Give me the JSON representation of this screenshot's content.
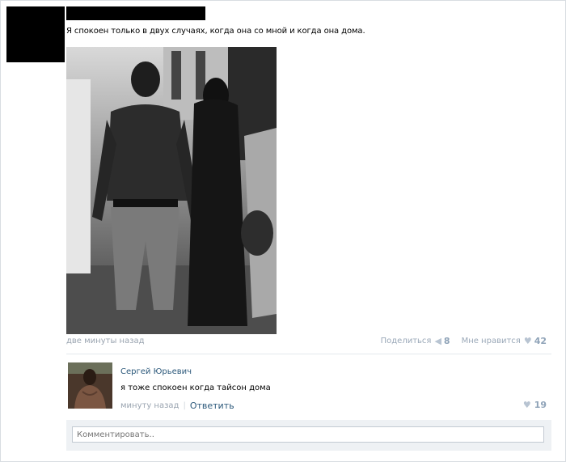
{
  "post": {
    "text": "Я спокоен только в двух случаях, когда она со мной и когда она дома.",
    "time": "две минуты назад",
    "share_label": "Поделиться",
    "share_count": "8",
    "like_label": "Мне нравится",
    "like_count": "42"
  },
  "comment": {
    "author": "Сергей Юрьевич",
    "text": "я тоже спокоен когда тайсон дома",
    "time": "минуту назад",
    "reply_label": "Ответить",
    "like_count": "19"
  },
  "reply_box": {
    "placeholder": "Комментировать.."
  },
  "icons": {
    "share": "megaphone-icon",
    "like": "heart-icon"
  },
  "colors": {
    "link": "#2b587a",
    "muted": "#9aa4b0",
    "count": "#8fa3b8"
  }
}
